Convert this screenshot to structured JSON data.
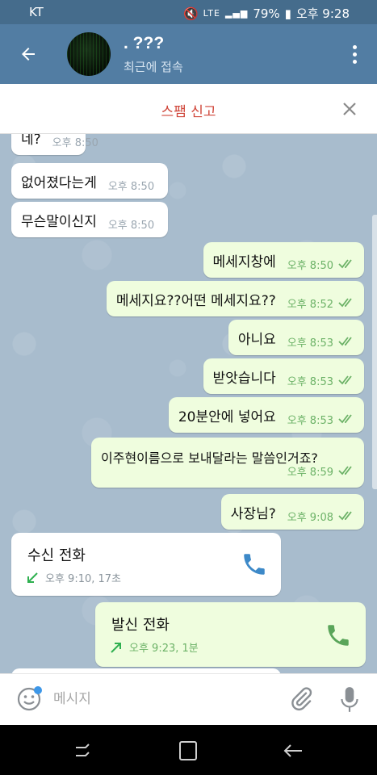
{
  "status_bar": {
    "carrier": "KT",
    "network": "LTE",
    "battery": "79%",
    "time": "오후 9:28"
  },
  "header": {
    "title": ". ???",
    "subtitle": "최근에 접속"
  },
  "spam_banner": {
    "label": "스팸 신고"
  },
  "messages": [
    {
      "dir": "in",
      "text": "네?",
      "time": "오후 8:50"
    },
    {
      "dir": "in",
      "text": "없어졌다는게",
      "time": "오후 8:50"
    },
    {
      "dir": "in",
      "text": "무슨말이신지",
      "time": "오후 8:50"
    },
    {
      "dir": "out",
      "text": "메세지창에",
      "time": "오후 8:50"
    },
    {
      "dir": "out",
      "text": "메세지요??어떤 메세지요??",
      "time": "오후 8:52"
    },
    {
      "dir": "out",
      "text": "아니요",
      "time": "오후 8:53"
    },
    {
      "dir": "out",
      "text": "받앗습니다",
      "time": "오후 8:53"
    },
    {
      "dir": "out",
      "text": "20분안에 넣어요",
      "time": "오후 8:53"
    },
    {
      "dir": "out",
      "text": "이주현이름으로 보내달라는 말씀인거죠?",
      "time": "오후 8:59"
    },
    {
      "dir": "out",
      "text": "사장님?",
      "time": "오후 9:08"
    }
  ],
  "calls": {
    "incoming": {
      "title": "수신 전화",
      "meta": "오후 9:10, 17초"
    },
    "outgoing": {
      "title": "발신 전화",
      "meta": "오후 9:23, 1분"
    }
  },
  "input": {
    "placeholder": "메시지"
  },
  "colors": {
    "header": "#527da3",
    "status_bar": "#456c8c",
    "outgoing_bubble": "#effdde",
    "check": "#6cb267",
    "spam_red": "#d0463a",
    "call_in_arrow": "#2fb050",
    "phone_in": "#3d89c8",
    "phone_out": "#5aa55a"
  },
  "icons": [
    "back-arrow-icon",
    "more-vert-icon",
    "close-icon",
    "double-check-icon",
    "incoming-call-arrow-icon",
    "outgoing-call-arrow-icon",
    "phone-icon",
    "emoji-icon",
    "attach-icon",
    "mic-icon",
    "recents-icon",
    "home-icon",
    "back-icon"
  ]
}
